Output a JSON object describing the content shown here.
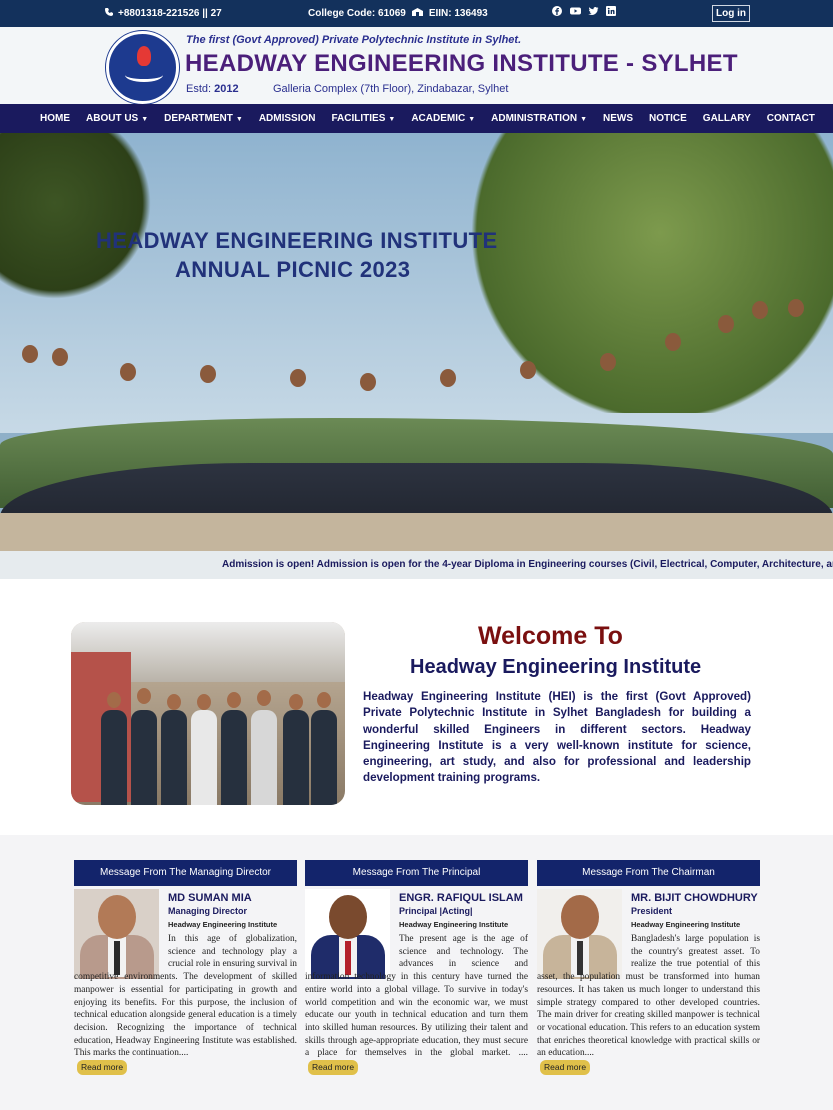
{
  "topbar": {
    "phone": "+8801318-221526 || 27",
    "college_code": "College Code: 61069",
    "eiin": "EIIN: 136493",
    "social_icons": [
      "facebook-icon",
      "youtube-icon",
      "twitter-icon",
      "linkedin-icon"
    ],
    "login": "Log in"
  },
  "header": {
    "tagline": "The first (Govt Approved) Private Polytechnic Institute in Sylhet.",
    "name": "HEADWAY ENGINEERING INSTITUTE - SYLHET",
    "estd_label": "Estd:",
    "estd_year": "2012",
    "address": "Galleria Complex (7th Floor), Zindabazar, Sylhet"
  },
  "nav": {
    "items": [
      {
        "label": "HOME",
        "dropdown": false
      },
      {
        "label": "ABOUT US",
        "dropdown": true
      },
      {
        "label": "DEPARTMENT",
        "dropdown": true
      },
      {
        "label": "ADMISSION",
        "dropdown": false
      },
      {
        "label": "FACILITIES",
        "dropdown": true
      },
      {
        "label": "ACADEMIC",
        "dropdown": true
      },
      {
        "label": "ADMINISTRATION",
        "dropdown": true
      },
      {
        "label": "NEWS",
        "dropdown": false
      },
      {
        "label": "NOTICE",
        "dropdown": false
      },
      {
        "label": "GALLARY",
        "dropdown": false
      },
      {
        "label": "CONTACT",
        "dropdown": false
      }
    ]
  },
  "hero": {
    "title_line1": "HEADWAY ENGINEERING INSTITUTE",
    "title_line2": "ANNUAL PICNIC 2023"
  },
  "marquee": {
    "text": "Admission is open! Admission is open for the 4-year Diploma in Engineering courses (Civil, Electrical, Computer, Architecture, and Text"
  },
  "welcome": {
    "title": "Welcome To",
    "subtitle": "Headway Engineering Institute",
    "text": "Headway Engineering Institute (HEI) is the first (Govt Approved) Private Polytechnic Institute in Sylhet Bangladesh for building a wonderful skilled Engineers in different sectors. Headway Engineering Institute is a very well-known institute for science, engineering, art study, and also for professional and leadership development training programs."
  },
  "messages": [
    {
      "heading": "Message From The Managing Director",
      "name": "MD SUMAN MIA",
      "role": "Managing Director",
      "institute": "Headway Engineering Institute",
      "text": "In this age of globalization, science and technology play a crucial role in ensuring survival in competitive environments. The development of skilled manpower is essential for participating in growth and enjoying its benefits. For this purpose, the inclusion of technical education alongside general education is a timely decision. Recognizing the importance of technical education, Headway Engineering Institute was established. This marks the continuation....",
      "more": "Read more"
    },
    {
      "heading": "Message From The Principal",
      "name": "ENGR. RAFIQUL ISLAM",
      "role": "Principal |Acting|",
      "institute": "Headway Engineering Institute",
      "text": "The present age is the age of science and technology. The advances in science and information technology in this century have turned the entire world into a global village. To survive in today's world competition and win the economic war, we must educate our youth in technical education and turn them into skilled human resources. By utilizing their talent and skills through age-appropriate education, they must secure a place for themselves in the global market. ....",
      "more": "Read more"
    },
    {
      "heading": "Message From The Chairman",
      "name": "MR. BIJIT CHOWDHURY",
      "role": "President",
      "institute": "Headway Engineering Institute",
      "text": "Bangladesh's large population is the country's greatest asset. To realize the true potential of this asset, the population must be transformed into human resources. It has taken us much longer to understand this simple strategy compared to other developed countries. The main driver for creating skilled manpower is technical or vocational education. This refers to an education system that enriches theoretical knowledge with practical skills or an education....",
      "more": "Read more"
    }
  ]
}
